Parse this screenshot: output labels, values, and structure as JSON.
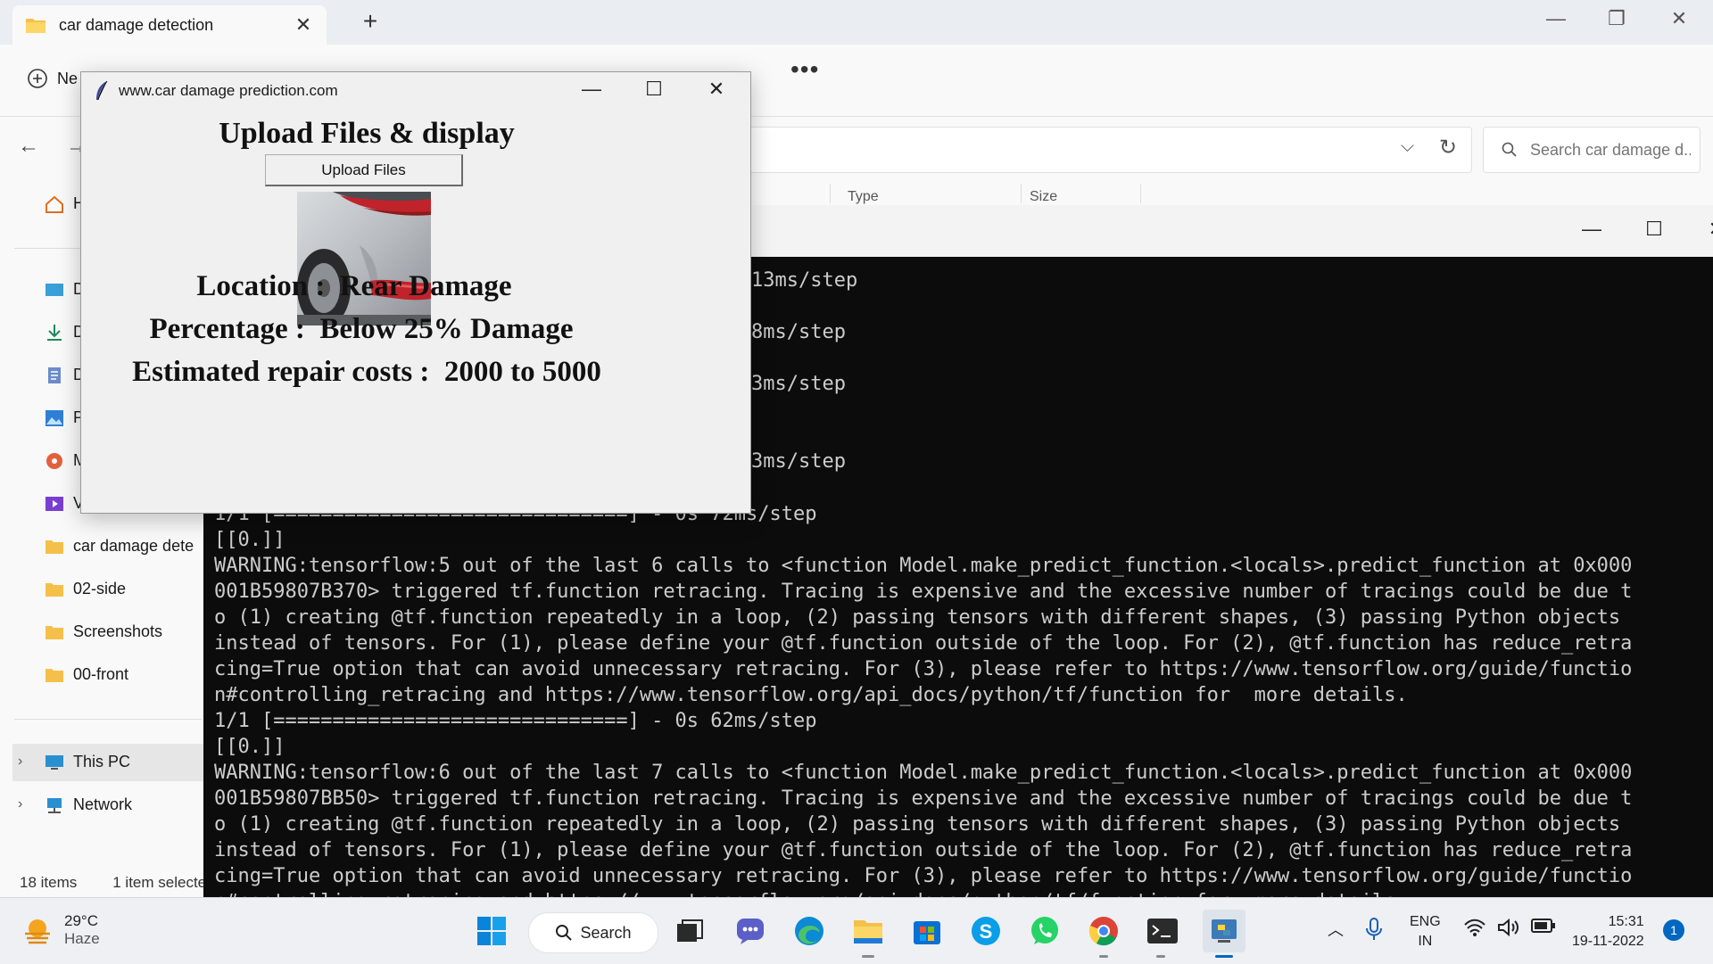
{
  "explorer": {
    "tab_title": "car damage detection",
    "new_label": "Ne",
    "more_label": "•••",
    "search_placeholder": "Search car damage d...",
    "col_type": "Type",
    "col_size": "Size",
    "sidebar": {
      "home": "H",
      "desktop": "D",
      "downloads": "D",
      "documents": "D",
      "pictures": "P",
      "music": "M",
      "videos": "V",
      "folders": [
        "car damage dete",
        "02-side",
        "Screenshots",
        "00-front"
      ],
      "this_pc": "This PC",
      "network": "Network"
    },
    "status_items": "18 items",
    "status_selected": "1 item selecte"
  },
  "tk_app": {
    "title": "www.car damage prediction.com",
    "heading": "Upload Files & display",
    "upload_button": "Upload Files",
    "location": "Location :  Rear Damage",
    "percentage": "Percentage :  Below 25% Damage",
    "cost": "Estimated repair costs :  2000 to 5000"
  },
  "terminal": {
    "steps": [
      "13ms/step",
      "8ms/step",
      "3ms/step",
      "3ms/step"
    ],
    "lines": [
      "1/1 [==============================] - 0s 72ms/step",
      "[[0.]]",
      "WARNING:tensorflow:5 out of the last 6 calls to <function Model.make_predict_function.<locals>.predict_function at 0x000",
      "001B59807B370> triggered tf.function retracing. Tracing is expensive and the excessive number of tracings could be due t",
      "o (1) creating @tf.function repeatedly in a loop, (2) passing tensors with different shapes, (3) passing Python objects",
      "instead of tensors. For (1), please define your @tf.function outside of the loop. For (2), @tf.function has reduce_retra",
      "cing=True option that can avoid unnecessary retracing. For (3), please refer to https://www.tensorflow.org/guide/functio",
      "n#controlling_retracing and https://www.tensorflow.org/api_docs/python/tf/function for  more details.",
      "1/1 [==============================] - 0s 62ms/step",
      "[[0.]]",
      "WARNING:tensorflow:6 out of the last 7 calls to <function Model.make_predict_function.<locals>.predict_function at 0x000",
      "001B59807BB50> triggered tf.function retracing. Tracing is expensive and the excessive number of tracings could be due t",
      "o (1) creating @tf.function repeatedly in a loop, (2) passing tensors with different shapes, (3) passing Python objects",
      "instead of tensors. For (1), please define your @tf.function outside of the loop. For (2), @tf.function has reduce_retra",
      "cing=True option that can avoid unnecessary retracing. For (3), please refer to https://www.tensorflow.org/guide/functio",
      "n#controlling_retracing and https://www.tensorflow.org/api_docs/python/tf/function for  more details."
    ]
  },
  "taskbar": {
    "temperature": "29°C",
    "condition": "Haze",
    "search_label": "Search",
    "lang_top": "ENG",
    "lang_bottom": "IN",
    "time": "15:31",
    "date": "19-11-2022",
    "notifications": "1"
  },
  "colors": {
    "accent": "#0067c0",
    "folder": "#f5c04a",
    "terminal_bg": "#0c0c0c",
    "terminal_fg": "#cccccc"
  }
}
